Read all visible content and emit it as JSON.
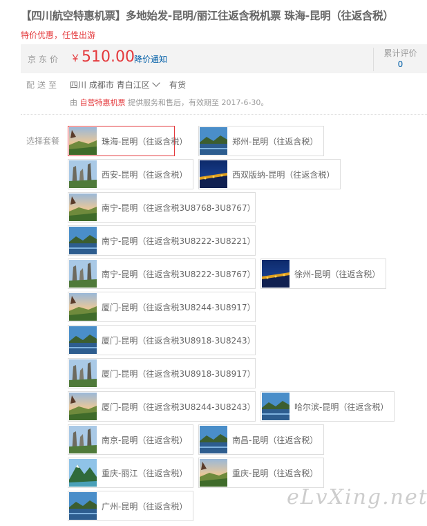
{
  "product": {
    "title": "【四川航空特惠机票】多地始发-昆明/丽江往返含税机票 珠海-昆明（往返含税）",
    "promo": "特价优惠，任性出游"
  },
  "price": {
    "label": "京东价",
    "currency": "￥",
    "value": "510.00",
    "notify": "降价通知",
    "review_label": "累计评价",
    "review_count": "0"
  },
  "shipping": {
    "label": "配送至",
    "location": "四川 成都市 青白江区",
    "stock": "有货"
  },
  "service": {
    "prefix": "由",
    "seller": "自营特惠机票",
    "suffix": "提供服务和售后，有效期至 2017-6-30。"
  },
  "options": {
    "label": "选择套餐",
    "items": [
      {
        "text": "珠海-昆明（往返含税）",
        "thumb": "sunset-field"
      },
      {
        "text": "郑州-昆明（往返含税）",
        "thumb": "lake"
      },
      {
        "text": "西安-昆明（往返含税）",
        "thumb": "stone-forest"
      },
      {
        "text": "西双版纳-昆明（往返含税）",
        "thumb": "night-city"
      },
      {
        "text": "南宁-昆明（往返含税3U8768-3U8767）",
        "thumb": "sunset-field"
      },
      {
        "text": "南宁-昆明（往返含税3U8222-3U8221）",
        "thumb": "lake"
      },
      {
        "text": "南宁-昆明（往返含税3U8222-3U8767）",
        "thumb": "stone-forest"
      },
      {
        "text": "徐州-昆明（往返含税）",
        "thumb": "night-city"
      },
      {
        "text": "厦门-昆明（往返含税3U8244-3U8917）",
        "thumb": "sunset-field"
      },
      {
        "text": "厦门-昆明（往返含税3U8918-3U8243）",
        "thumb": "lake"
      },
      {
        "text": "厦门-昆明（往返含税3U8918-3U8917）",
        "thumb": "stone-forest"
      },
      {
        "text": "厦门-昆明（往返含税3U8244-3U8243）",
        "thumb": "sunset-field"
      },
      {
        "text": "哈尔滨-昆明（往返含税）",
        "thumb": "lake"
      },
      {
        "text": "南京-昆明（往返含税）",
        "thumb": "stone-forest"
      },
      {
        "text": "南昌-昆明（往返含税）",
        "thumb": "lake"
      },
      {
        "text": "重庆-丽江（往返含税）",
        "thumb": "mountain"
      },
      {
        "text": "重庆-昆明（往返含税）",
        "thumb": "sunset-field"
      },
      {
        "text": "广州-昆明（往返含税）",
        "thumb": "lake"
      }
    ]
  },
  "watermark": "eLvXing.net",
  "colors": {
    "price_red": "#e4393c",
    "link_blue": "#005ea7",
    "selected_border": "#e4393c"
  }
}
